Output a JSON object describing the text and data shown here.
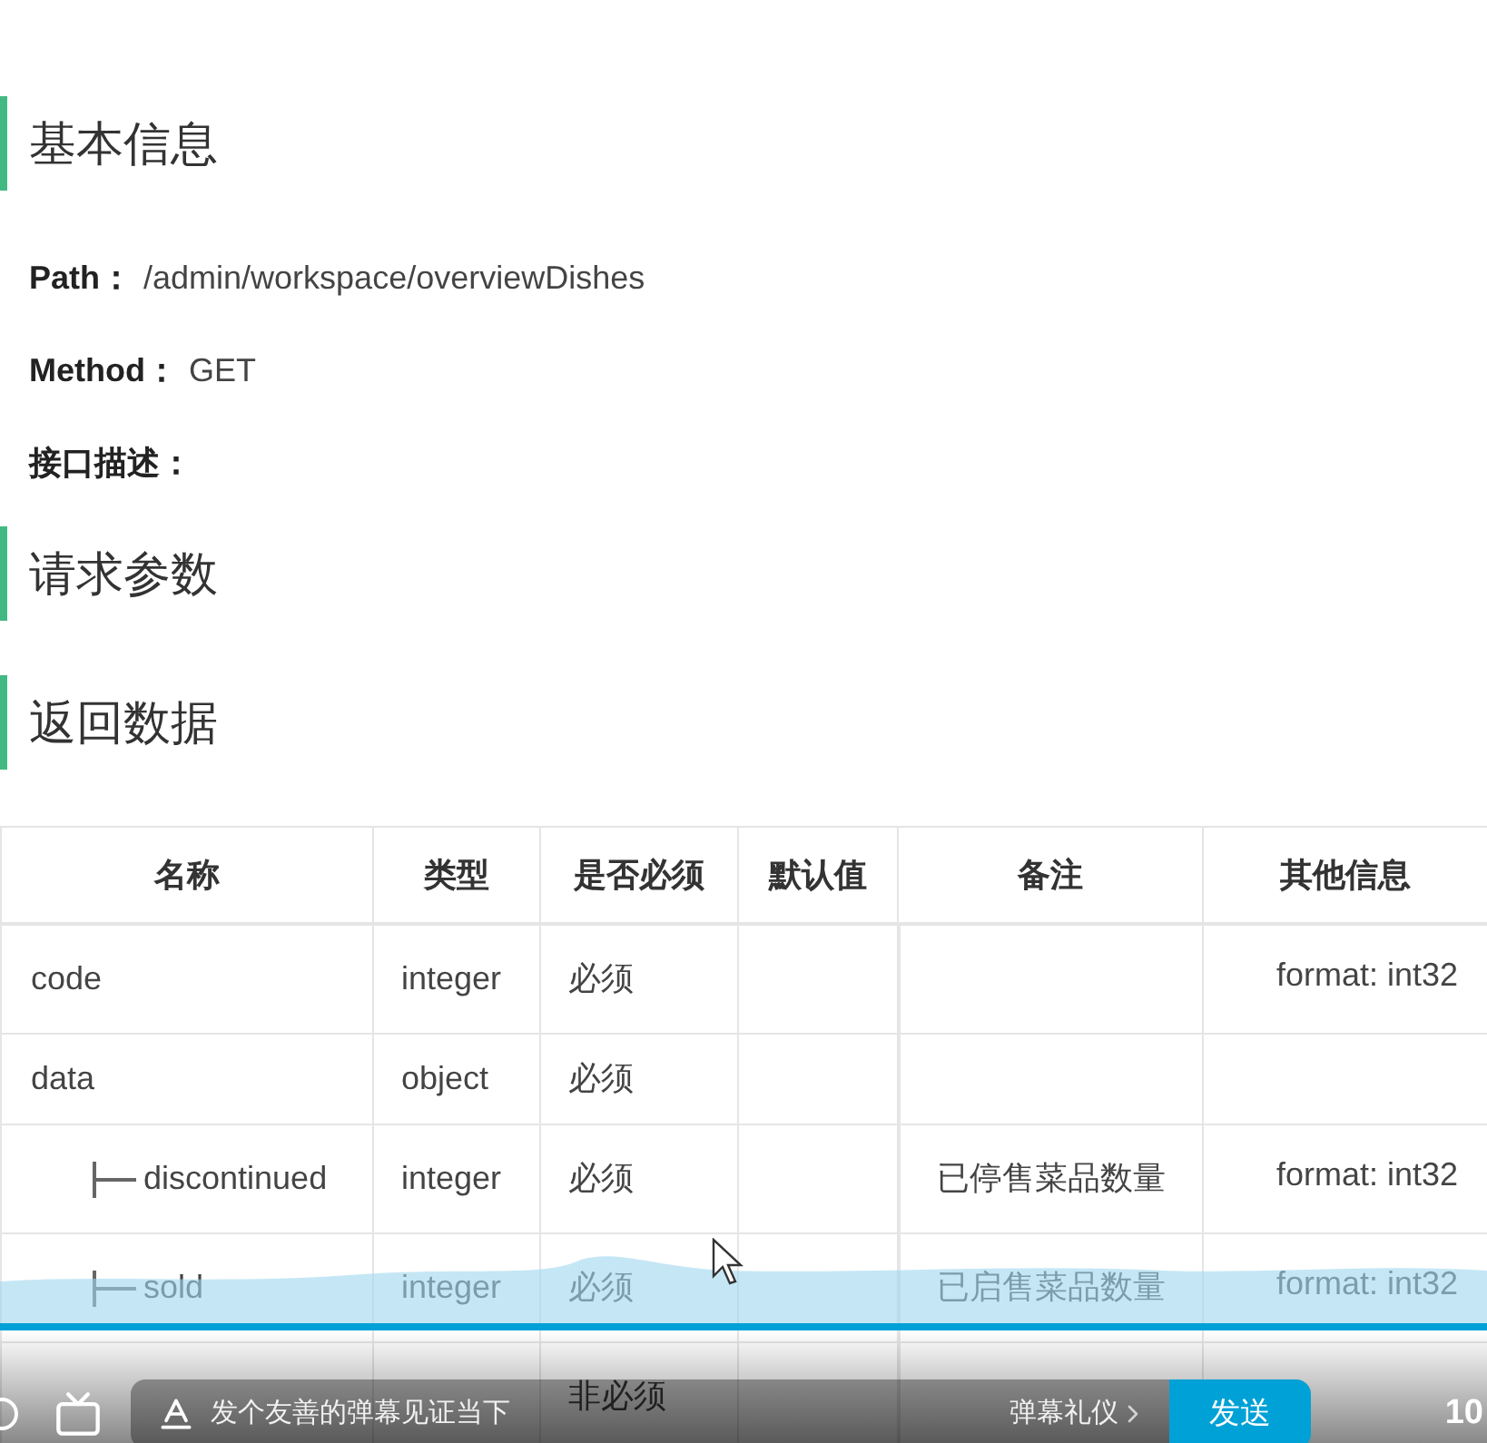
{
  "sections": [
    {
      "title": "基本信息",
      "fields": [
        {
          "label": "Path：",
          "value": "/admin/workspace/overviewDishes"
        },
        {
          "label": "Method：",
          "value": "GET"
        },
        {
          "label": "接口描述："
        }
      ]
    },
    {
      "title": "请求参数"
    },
    {
      "title": "返回数据"
    }
  ],
  "table": {
    "columns": [
      "名称",
      "类型",
      "是否必须",
      "默认值",
      "备注",
      "其他信息"
    ],
    "rows": [
      {
        "name": "code",
        "type": "integer",
        "required": "必须",
        "other": "format: int32"
      },
      {
        "name": "data",
        "type": "object",
        "required": "必须",
        "children": [
          {
            "name": "discontinued",
            "type": "integer",
            "required": "必须",
            "note": "已停售菜品数量",
            "other": "format: int32"
          },
          {
            "name": "sold",
            "type": "integer",
            "required": "必须",
            "note": "已启售菜品数量",
            "other": "format: int32"
          }
        ]
      },
      {
        "required": "非必须"
      }
    ]
  },
  "player": {
    "placeholder": "发个友善的弹幕见证当下",
    "etiquette": "弹幕礼仪",
    "send": "发送",
    "count": "10"
  }
}
